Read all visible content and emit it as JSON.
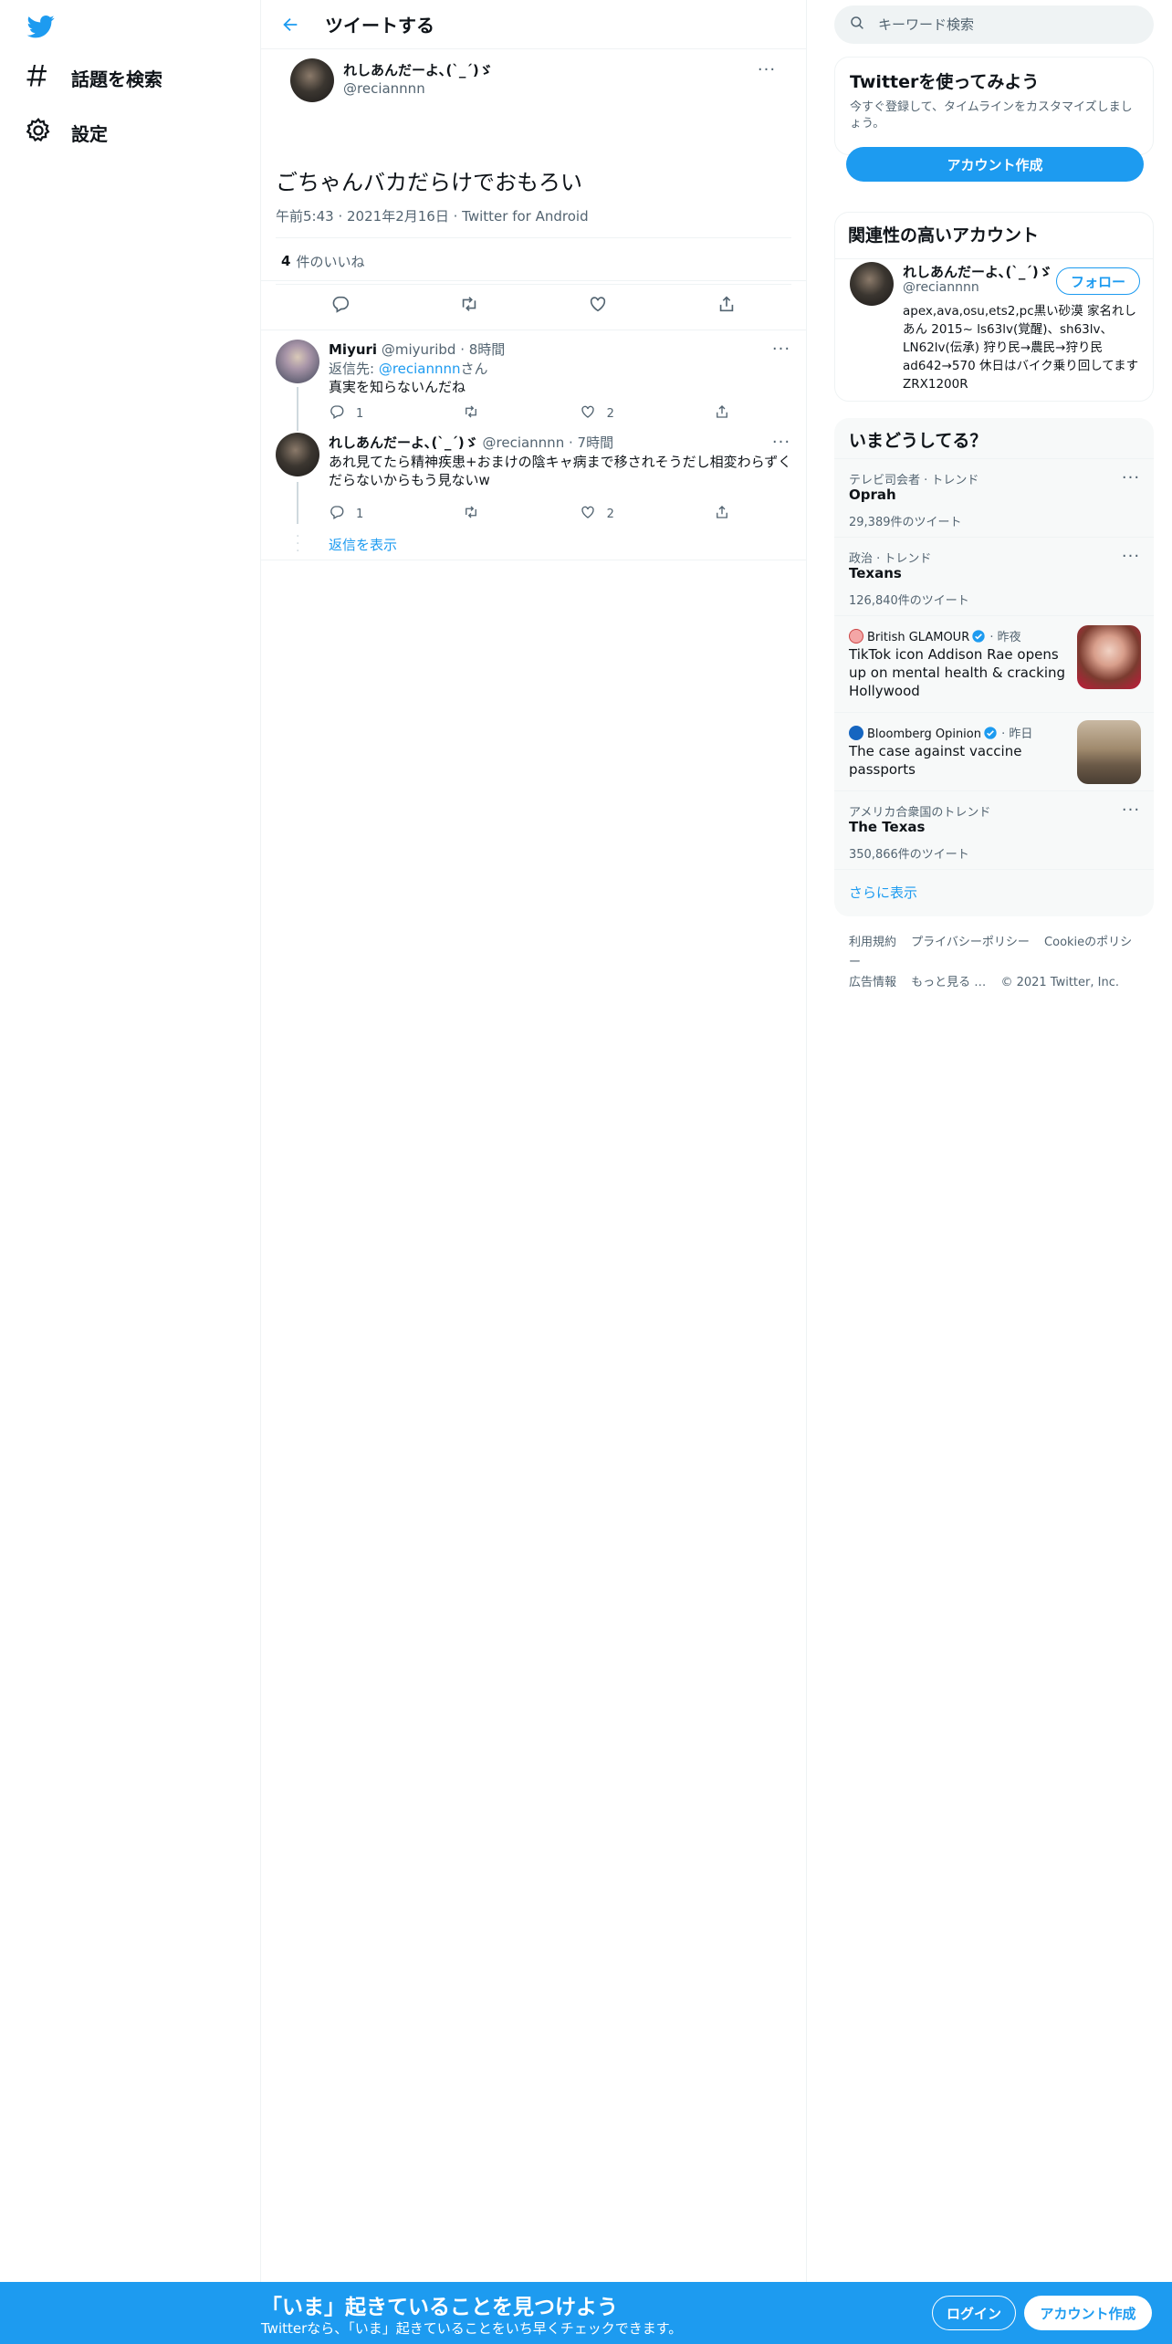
{
  "nav": {
    "logo": "twitter-bird-icon",
    "items": [
      {
        "label": "話題を検索",
        "icon": "hashtag-icon"
      },
      {
        "label": "設定",
        "icon": "gear-icon"
      }
    ]
  },
  "header": {
    "title": "ツイートする"
  },
  "main_tweet": {
    "name": "れしあんだーよ､(`_´)ゞ",
    "handle": "@reciannnn",
    "text": "ごちゃんバカだらけでおもろい",
    "time": "午前5:43",
    "date": "2021年2月16日",
    "source": "Twitter for Android",
    "likes_count": "4",
    "likes_label": "件のいいね"
  },
  "replies": [
    {
      "name": "Miyuri",
      "handle": "@miyuribd",
      "time": "8時間",
      "reply_to_prefix": "返信先: ",
      "reply_to_handle": "@reciannnn",
      "reply_to_suffix": "さん",
      "text": "真実を知らないんだね",
      "reply_count": "1",
      "like_count": "2"
    },
    {
      "name": "れしあんだーよ､(`_´)ゞ",
      "handle": "@reciannnn",
      "time": "7時間",
      "text": "あれ見てたら精神疾患+おまけの陰キャ病まで移されそうだし相変わらずくだらないからもう見ないw",
      "reply_count": "1",
      "like_count": "2"
    }
  ],
  "show_replies": "返信を表示",
  "search": {
    "placeholder": "キーワード検索"
  },
  "signup_card": {
    "title": "Twitterを使ってみよう",
    "desc": "今すぐ登録して、タイムラインをカスタマイズしましょう。",
    "button": "アカウント作成"
  },
  "related": {
    "title": "関連性の高いアカウント",
    "name": "れしあんだーよ､(`_´)ゞ",
    "handle": "@reciannnn",
    "follow": "フォロー",
    "bio": "apex,ava,osu,ets2,pc黒い砂漠 家名れしあん 2015~ ls63lv(覚醒)、sh63lv、LN62lv(伝承) 狩り民→農民→狩り民 ad642→570 休日はバイク乗り回してます ZRX1200R"
  },
  "trends": {
    "title": "いまどうしてる？",
    "items": [
      {
        "context": "テレビ司会者 · トレンド",
        "name": "Oprah",
        "count": "29,389件のツイート"
      },
      {
        "context": "政治 · トレンド",
        "name": "Texans",
        "count": "126,840件のツイート"
      },
      {
        "source": "British GLAMOUR",
        "when": "昨夜",
        "headline": "TikTok icon Addison Rae opens up on mental health & cracking Hollywood"
      },
      {
        "source": "Bloomberg Opinion",
        "when": "昨日",
        "headline": "The case against vaccine passports"
      },
      {
        "context": "アメリカ合衆国のトレンド",
        "name": "The Texas",
        "count": "350,866件のツイート"
      }
    ],
    "more": "さらに表示"
  },
  "footer": {
    "links": [
      "利用規約",
      "プライバシーポリシー",
      "Cookieのポリシー",
      "広告情報",
      "もっと見る …"
    ],
    "copyright": "© 2021 Twitter, Inc."
  },
  "bottom_bar": {
    "headline": "「いま」起きていることを見つけよう",
    "sub": "Twitterなら、「いま」起きていることをいち早くチェックできます。",
    "login": "ログイン",
    "signup": "アカウント作成"
  },
  "colors": {
    "accent": "#1d9bf0",
    "text": "#0f1419",
    "muted": "#536471",
    "border": "#eff3f4"
  }
}
